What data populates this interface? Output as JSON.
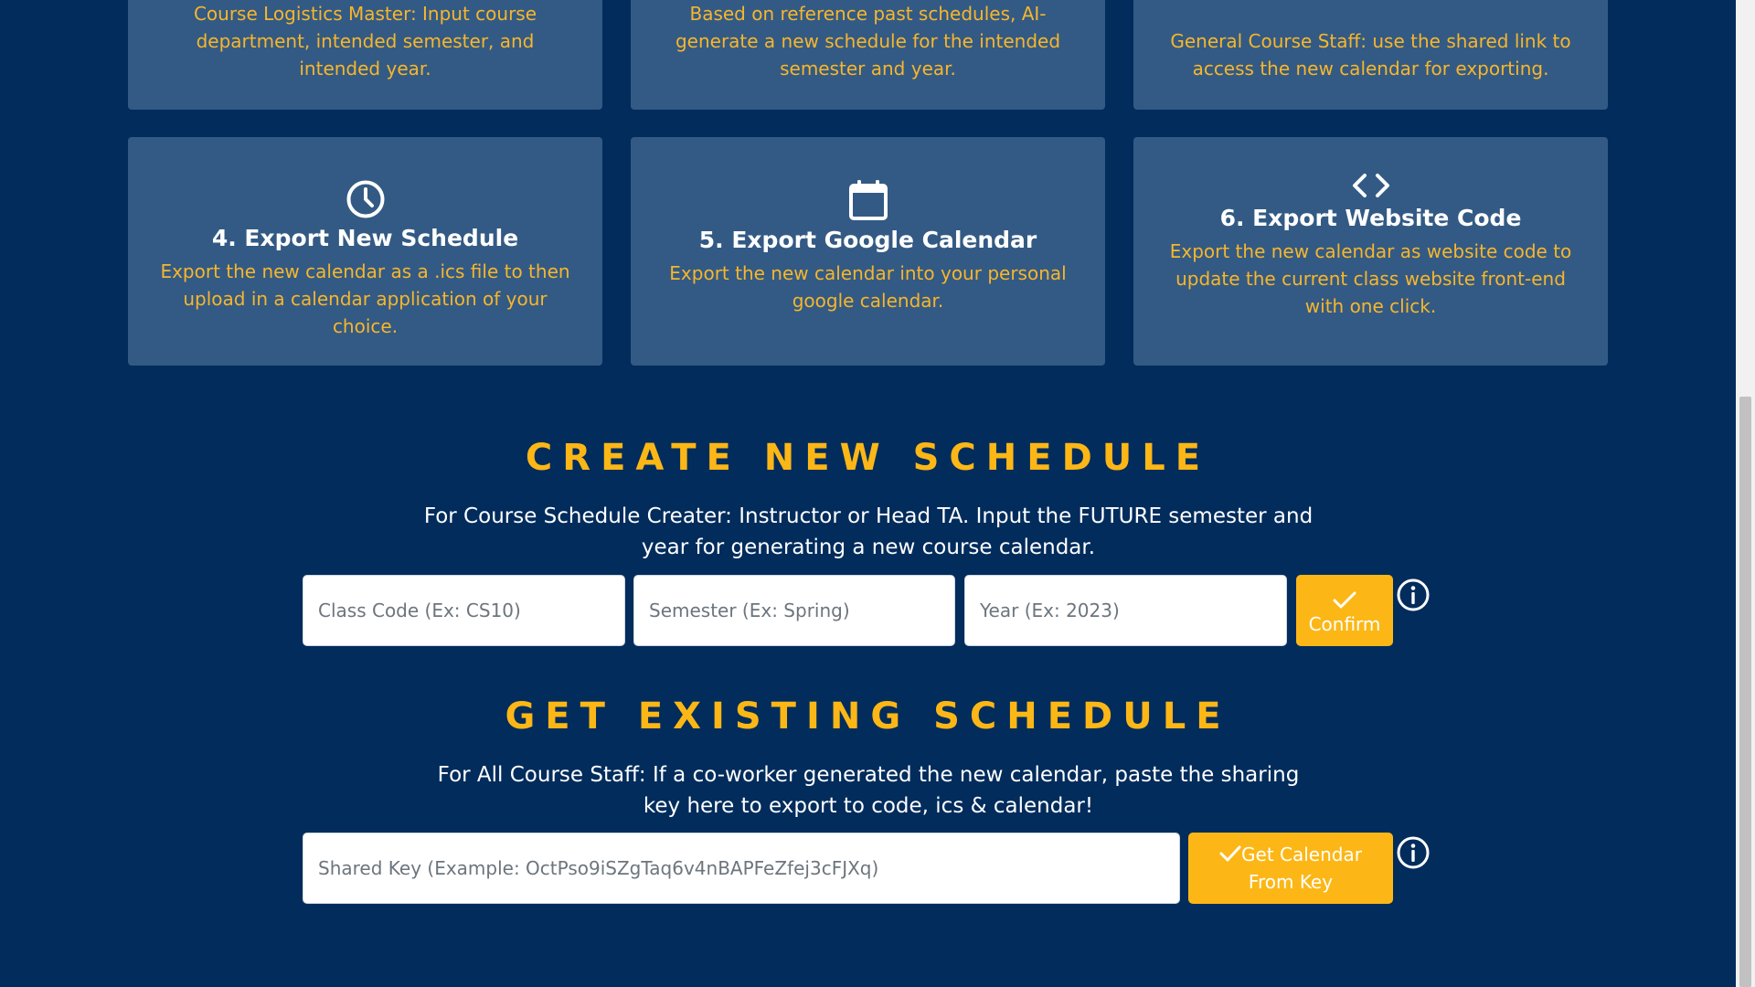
{
  "cards": {
    "top": [
      {
        "desc": "Course Logistics Master: Input course department, intended semester, and intended year."
      },
      {
        "desc": "Based on reference past schedules, AI-generate a new schedule for the intended semester and year."
      },
      {
        "desc": "General Course Staff: use the shared link to access the new calendar for exporting."
      }
    ],
    "bottom": [
      {
        "icon": "clock-icon",
        "title": "4. Export New Schedule",
        "desc": "Export the new calendar as a .ics file to then upload in a calendar application of your choice."
      },
      {
        "icon": "calendar-icon",
        "title": "5. Export Google Calendar",
        "desc": "Export the new calendar into your personal google calendar."
      },
      {
        "icon": "code-icon",
        "title": "6. Export Website Code",
        "desc": "Export the new calendar as website code to update the current class website front-end with one click."
      }
    ]
  },
  "create": {
    "title": "CREATE NEW SCHEDULE",
    "text": "For Course Schedule Creater: Instructor or Head TA. Input the FUTURE semester and year for generating a new course calendar.",
    "class_code_placeholder": "Class Code (Ex: CS10)",
    "semester_placeholder": "Semester (Ex: Spring)",
    "year_placeholder": "Year (Ex: 2023)",
    "confirm_label": "Confirm"
  },
  "existing": {
    "title": "GET EXISTING SCHEDULE",
    "text": "For All Course Staff: If a co-worker generated the new calendar, paste the sharing key here to export to code, ics & calendar!",
    "key_placeholder": "Shared Key (Example: OctPso9iSZgTaq6v4nBAPFeZfej3cFJXq)",
    "button_label": "Get Calendar From Key"
  },
  "colors": {
    "background": "#012c5c",
    "card": "#335a84",
    "accent": "#fcb716",
    "card_text": "#f7b62c"
  }
}
